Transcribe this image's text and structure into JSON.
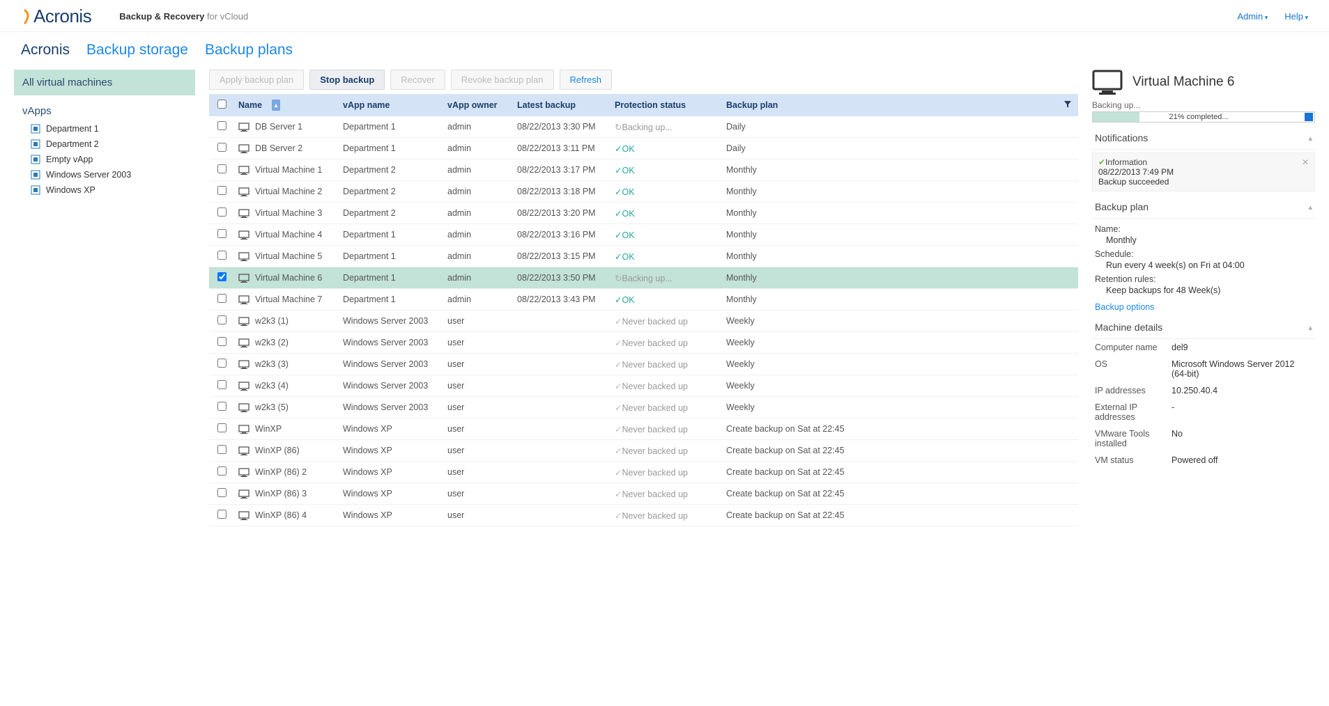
{
  "brand": "Acronis",
  "product_bold": "Backup & Recovery",
  "product_light": " for vCloud",
  "header": {
    "admin": "Admin",
    "help": "Help"
  },
  "tabs": {
    "t0": "Acronis",
    "t1": "Backup storage",
    "t2": "Backup plans"
  },
  "sidebar": {
    "selected": "All virtual machines",
    "vapps_head": "vApps",
    "items": [
      "Department 1",
      "Department 2",
      "Empty vApp",
      "Windows Server 2003",
      "Windows XP"
    ]
  },
  "toolbar": {
    "apply": "Apply backup plan",
    "stop": "Stop backup",
    "recover": "Recover",
    "revoke": "Revoke backup plan",
    "refresh": "Refresh"
  },
  "columns": {
    "name": "Name",
    "vapp": "vApp name",
    "owner": "vApp owner",
    "latest": "Latest backup",
    "status": "Protection status",
    "plan": "Backup plan"
  },
  "rows": [
    {
      "name": "DB Server 1",
      "vapp": "Department 1",
      "owner": "admin",
      "latest": "08/22/2013 3:30 PM",
      "status": "Backing up...",
      "st": "busy",
      "plan": "Daily",
      "chk": false
    },
    {
      "name": "DB Server 2",
      "vapp": "Department 1",
      "owner": "admin",
      "latest": "08/22/2013 3:11 PM",
      "status": "OK",
      "st": "ok",
      "plan": "Daily",
      "chk": false
    },
    {
      "name": "Virtual Machine 1",
      "vapp": "Department 2",
      "owner": "admin",
      "latest": "08/22/2013 3:17 PM",
      "status": "OK",
      "st": "ok",
      "plan": "Monthly",
      "chk": false
    },
    {
      "name": "Virtual Machine 2",
      "vapp": "Department 2",
      "owner": "admin",
      "latest": "08/22/2013 3:18 PM",
      "status": "OK",
      "st": "ok",
      "plan": "Monthly",
      "chk": false
    },
    {
      "name": "Virtual Machine 3",
      "vapp": "Department 2",
      "owner": "admin",
      "latest": "08/22/2013 3:20 PM",
      "status": "OK",
      "st": "ok",
      "plan": "Monthly",
      "chk": false
    },
    {
      "name": "Virtual Machine 4",
      "vapp": "Department 1",
      "owner": "admin",
      "latest": "08/22/2013 3:16 PM",
      "status": "OK",
      "st": "ok",
      "plan": "Monthly",
      "chk": false
    },
    {
      "name": "Virtual Machine 5",
      "vapp": "Department 1",
      "owner": "admin",
      "latest": "08/22/2013 3:15 PM",
      "status": "OK",
      "st": "ok",
      "plan": "Monthly",
      "chk": false
    },
    {
      "name": "Virtual Machine 6",
      "vapp": "Department 1",
      "owner": "admin",
      "latest": "08/22/2013 3:50 PM",
      "status": "Backing up...",
      "st": "busy",
      "plan": "Monthly",
      "chk": true,
      "sel": true
    },
    {
      "name": "Virtual Machine 7",
      "vapp": "Department 1",
      "owner": "admin",
      "latest": "08/22/2013 3:43 PM",
      "status": "OK",
      "st": "ok",
      "plan": "Monthly",
      "chk": false
    },
    {
      "name": "w2k3 (1)",
      "vapp": "Windows Server 2003",
      "owner": "user",
      "latest": "",
      "status": "Never backed up",
      "st": "never",
      "plan": "Weekly",
      "chk": false
    },
    {
      "name": "w2k3 (2)",
      "vapp": "Windows Server 2003",
      "owner": "user",
      "latest": "",
      "status": "Never backed up",
      "st": "never",
      "plan": "Weekly",
      "chk": false
    },
    {
      "name": "w2k3 (3)",
      "vapp": "Windows Server 2003",
      "owner": "user",
      "latest": "",
      "status": "Never backed up",
      "st": "never",
      "plan": "Weekly",
      "chk": false
    },
    {
      "name": "w2k3 (4)",
      "vapp": "Windows Server 2003",
      "owner": "user",
      "latest": "",
      "status": "Never backed up",
      "st": "never",
      "plan": "Weekly",
      "chk": false
    },
    {
      "name": "w2k3 (5)",
      "vapp": "Windows Server 2003",
      "owner": "user",
      "latest": "",
      "status": "Never backed up",
      "st": "never",
      "plan": "Weekly",
      "chk": false
    },
    {
      "name": "WinXP",
      "vapp": "Windows XP",
      "owner": "user",
      "latest": "",
      "status": "Never backed up",
      "st": "never",
      "plan": "Create backup on Sat at 22:45",
      "chk": false
    },
    {
      "name": "WinXP (86)",
      "vapp": "Windows XP",
      "owner": "user",
      "latest": "",
      "status": "Never backed up",
      "st": "never",
      "plan": "Create backup on Sat at 22:45",
      "chk": false
    },
    {
      "name": "WinXP (86) 2",
      "vapp": "Windows XP",
      "owner": "user",
      "latest": "",
      "status": "Never backed up",
      "st": "never",
      "plan": "Create backup on Sat at 22:45",
      "chk": false
    },
    {
      "name": "WinXP (86) 3",
      "vapp": "Windows XP",
      "owner": "user",
      "latest": "",
      "status": "Never backed up",
      "st": "never",
      "plan": "Create backup on Sat at 22:45",
      "chk": false
    },
    {
      "name": "WinXP (86) 4",
      "vapp": "Windows XP",
      "owner": "user",
      "latest": "",
      "status": "Never backed up",
      "st": "never",
      "plan": "Create backup on Sat at 22:45",
      "chk": false
    }
  ],
  "rpanel": {
    "title": "Virtual Machine 6",
    "progress_label": "Backing up...",
    "progress_text": "21% completed...",
    "progress_pct": 21,
    "notifications_head": "Notifications",
    "notif": {
      "title": "Information",
      "date": "08/22/2013 7:49 PM",
      "msg": "Backup succeeded"
    },
    "plan_head": "Backup plan",
    "plan": {
      "name_lbl": "Name:",
      "name": "Monthly",
      "sched_lbl": "Schedule:",
      "sched": "Run every 4 week(s) on Fri at 04:00",
      "ret_lbl": "Retention rules:",
      "ret": "Keep backups for 48 Week(s)",
      "options": "Backup options"
    },
    "details_head": "Machine details",
    "details": [
      {
        "k": "Computer name",
        "v": "del9"
      },
      {
        "k": "OS",
        "v": "Microsoft Windows Server 2012 (64-bit)"
      },
      {
        "k": "IP addresses",
        "v": "10.250.40.4"
      },
      {
        "k": "External IP addresses",
        "v": "-"
      },
      {
        "k": "VMware Tools installed",
        "v": "No"
      },
      {
        "k": "VM status",
        "v": "Powered off"
      }
    ]
  }
}
